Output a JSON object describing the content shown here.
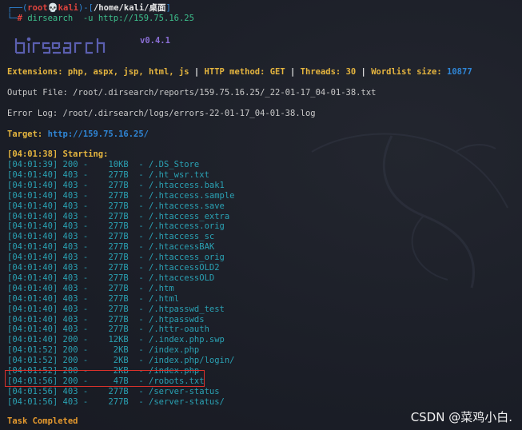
{
  "prompt": {
    "user": "root",
    "host": "kali",
    "path": "/home/kali/桌面",
    "command": "dirsearch  -u http://159.75.16.25"
  },
  "banner": {
    "logo_text": "dirsearch",
    "version": "v0.4.1"
  },
  "config": {
    "extensions_label": "Extensions: ",
    "extensions_value": "php, aspx, jsp, html, js",
    "method_label": "HTTP method: ",
    "method_value": "GET",
    "threads_label": "Threads: ",
    "threads_value": "30",
    "wordlist_label": "Wordlist size: ",
    "wordlist_value": "10877",
    "separator": " | "
  },
  "output_file": "Output File: /root/.dirsearch/reports/159.75.16.25/_22-01-17_04-01-38.txt",
  "error_log": "Error Log: /root/.dirsearch/logs/errors-22-01-17_04-01-38.log",
  "target": {
    "label": "Target: ",
    "value": "http://159.75.16.25/"
  },
  "starting": "[04:01:38] Starting:",
  "results": [
    {
      "time": "[04:01:39]",
      "code": "200",
      "size": "10KB",
      "path": "/.DS_Store"
    },
    {
      "time": "[04:01:40]",
      "code": "403",
      "size": "277B",
      "path": "/.ht_wsr.txt"
    },
    {
      "time": "[04:01:40]",
      "code": "403",
      "size": "277B",
      "path": "/.htaccess.bak1"
    },
    {
      "time": "[04:01:40]",
      "code": "403",
      "size": "277B",
      "path": "/.htaccess.sample"
    },
    {
      "time": "[04:01:40]",
      "code": "403",
      "size": "277B",
      "path": "/.htaccess.save"
    },
    {
      "time": "[04:01:40]",
      "code": "403",
      "size": "277B",
      "path": "/.htaccess_extra"
    },
    {
      "time": "[04:01:40]",
      "code": "403",
      "size": "277B",
      "path": "/.htaccess.orig"
    },
    {
      "time": "[04:01:40]",
      "code": "403",
      "size": "277B",
      "path": "/.htaccess_sc"
    },
    {
      "time": "[04:01:40]",
      "code": "403",
      "size": "277B",
      "path": "/.htaccessBAK"
    },
    {
      "time": "[04:01:40]",
      "code": "403",
      "size": "277B",
      "path": "/.htaccess_orig"
    },
    {
      "time": "[04:01:40]",
      "code": "403",
      "size": "277B",
      "path": "/.htaccessOLD2"
    },
    {
      "time": "[04:01:40]",
      "code": "403",
      "size": "277B",
      "path": "/.htaccessOLD"
    },
    {
      "time": "[04:01:40]",
      "code": "403",
      "size": "277B",
      "path": "/.htm"
    },
    {
      "time": "[04:01:40]",
      "code": "403",
      "size": "277B",
      "path": "/.html"
    },
    {
      "time": "[04:01:40]",
      "code": "403",
      "size": "277B",
      "path": "/.htpasswd_test"
    },
    {
      "time": "[04:01:40]",
      "code": "403",
      "size": "277B",
      "path": "/.htpasswds"
    },
    {
      "time": "[04:01:40]",
      "code": "403",
      "size": "277B",
      "path": "/.httr-oauth"
    },
    {
      "time": "[04:01:40]",
      "code": "200",
      "size": "12KB",
      "path": "/.index.php.swp"
    },
    {
      "time": "[04:01:52]",
      "code": "200",
      "size": "2KB",
      "path": "/index.php"
    },
    {
      "time": "[04:01:52]",
      "code": "200",
      "size": "2KB",
      "path": "/index.php/login/"
    },
    {
      "time": "[04:01:52]",
      "code": "200",
      "size": "2KB",
      "path": "/index.php"
    },
    {
      "time": "[04:01:56]",
      "code": "200",
      "size": "47B",
      "path": "/robots.txt"
    },
    {
      "time": "[04:01:56]",
      "code": "403",
      "size": "277B",
      "path": "/server-status"
    },
    {
      "time": "[04:01:56]",
      "code": "403",
      "size": "277B",
      "path": "/server-status/"
    }
  ],
  "task_completed": "Task Completed",
  "watermark": "CSDN @菜鸡小白.",
  "colors": {
    "background": "#1b1e27",
    "prompt_blue": "#2f86d6",
    "root_red": "#e0443e",
    "config_yellow": "#e5b53f",
    "result_cyan": "#2aa1b3",
    "highlight_red": "#d9312b"
  }
}
